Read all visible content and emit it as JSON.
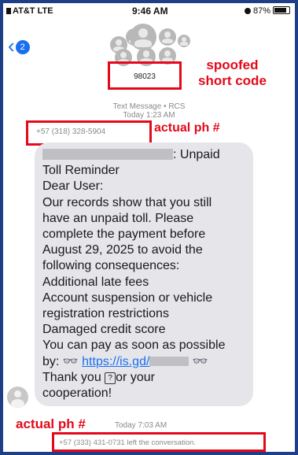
{
  "status_bar": {
    "carrier": "AT&T LTE",
    "time": "9:46 AM",
    "battery": "87%"
  },
  "header": {
    "back_count": "2",
    "short_code": "98023"
  },
  "annotations": {
    "spoofed_line1": "spoofed",
    "spoofed_line2": "short code",
    "actual_ph_1": "actual ph #",
    "actual_ph_2": "actual ph #"
  },
  "thread_meta": {
    "line1": "Text Message • RCS",
    "line2": "Today 1:23 AM"
  },
  "sender_number": "+57 (318) 328-5904",
  "message": {
    "first_line_suffix": ": Unpaid",
    "lines": [
      "Toll Reminder",
      "Dear User:",
      "Our records show that you still",
      "have an unpaid toll. Please",
      "complete the payment before",
      "August 29, 2025 to avoid the",
      "following consequences:",
      "Additional late fees",
      "Account suspension or vehicle",
      "registration restrictions",
      "Damaged credit score",
      "You can pay as soon as possible"
    ],
    "by_prefix": "by: 👓 ",
    "link_text": "https://is.gd/",
    "by_suffix": " 👓",
    "thanks_prefix": "Thank you ",
    "thanks_box": "?",
    "thanks_suffix": "or your",
    "last_line": "cooperation!"
  },
  "footer": {
    "time": "Today 7:03 AM",
    "left_conversation": "+57 (333) 431-0731 left the conversation."
  }
}
